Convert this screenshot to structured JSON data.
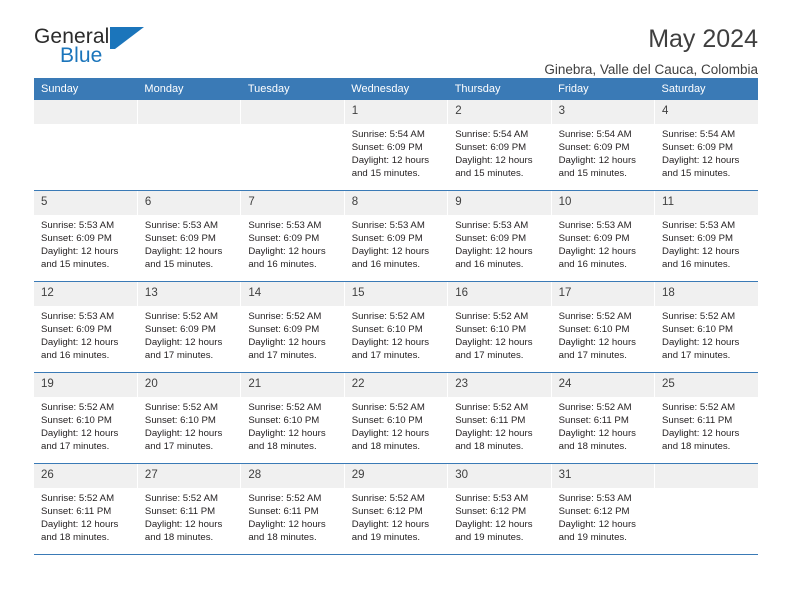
{
  "logo": {
    "text_top": "General",
    "text_bottom": "Blue",
    "mark": "triangle-logo-icon",
    "color_dark": "#2b2b2b",
    "color_blue": "#1b75bb"
  },
  "header": {
    "title": "May 2024",
    "subtitle": "Ginebra, Valle del Cauca, Colombia"
  },
  "theme": {
    "header_blue": "#3a7ab6",
    "daynum_bg": "#f0f0f0",
    "text": "#231f20"
  },
  "calendar": {
    "weekday_headers": [
      "Sunday",
      "Monday",
      "Tuesday",
      "Wednesday",
      "Thursday",
      "Friday",
      "Saturday"
    ],
    "weeks": [
      [
        {
          "day": "",
          "blank": true
        },
        {
          "day": "",
          "blank": true
        },
        {
          "day": "",
          "blank": true
        },
        {
          "day": "1",
          "sunrise": "Sunrise: 5:54 AM",
          "sunset": "Sunset: 6:09 PM",
          "daylight": "Daylight: 12 hours and 15 minutes."
        },
        {
          "day": "2",
          "sunrise": "Sunrise: 5:54 AM",
          "sunset": "Sunset: 6:09 PM",
          "daylight": "Daylight: 12 hours and 15 minutes."
        },
        {
          "day": "3",
          "sunrise": "Sunrise: 5:54 AM",
          "sunset": "Sunset: 6:09 PM",
          "daylight": "Daylight: 12 hours and 15 minutes."
        },
        {
          "day": "4",
          "sunrise": "Sunrise: 5:54 AM",
          "sunset": "Sunset: 6:09 PM",
          "daylight": "Daylight: 12 hours and 15 minutes."
        }
      ],
      [
        {
          "day": "5",
          "sunrise": "Sunrise: 5:53 AM",
          "sunset": "Sunset: 6:09 PM",
          "daylight": "Daylight: 12 hours and 15 minutes."
        },
        {
          "day": "6",
          "sunrise": "Sunrise: 5:53 AM",
          "sunset": "Sunset: 6:09 PM",
          "daylight": "Daylight: 12 hours and 15 minutes."
        },
        {
          "day": "7",
          "sunrise": "Sunrise: 5:53 AM",
          "sunset": "Sunset: 6:09 PM",
          "daylight": "Daylight: 12 hours and 16 minutes."
        },
        {
          "day": "8",
          "sunrise": "Sunrise: 5:53 AM",
          "sunset": "Sunset: 6:09 PM",
          "daylight": "Daylight: 12 hours and 16 minutes."
        },
        {
          "day": "9",
          "sunrise": "Sunrise: 5:53 AM",
          "sunset": "Sunset: 6:09 PM",
          "daylight": "Daylight: 12 hours and 16 minutes."
        },
        {
          "day": "10",
          "sunrise": "Sunrise: 5:53 AM",
          "sunset": "Sunset: 6:09 PM",
          "daylight": "Daylight: 12 hours and 16 minutes."
        },
        {
          "day": "11",
          "sunrise": "Sunrise: 5:53 AM",
          "sunset": "Sunset: 6:09 PM",
          "daylight": "Daylight: 12 hours and 16 minutes."
        }
      ],
      [
        {
          "day": "12",
          "sunrise": "Sunrise: 5:53 AM",
          "sunset": "Sunset: 6:09 PM",
          "daylight": "Daylight: 12 hours and 16 minutes."
        },
        {
          "day": "13",
          "sunrise": "Sunrise: 5:52 AM",
          "sunset": "Sunset: 6:09 PM",
          "daylight": "Daylight: 12 hours and 17 minutes."
        },
        {
          "day": "14",
          "sunrise": "Sunrise: 5:52 AM",
          "sunset": "Sunset: 6:09 PM",
          "daylight": "Daylight: 12 hours and 17 minutes."
        },
        {
          "day": "15",
          "sunrise": "Sunrise: 5:52 AM",
          "sunset": "Sunset: 6:10 PM",
          "daylight": "Daylight: 12 hours and 17 minutes."
        },
        {
          "day": "16",
          "sunrise": "Sunrise: 5:52 AM",
          "sunset": "Sunset: 6:10 PM",
          "daylight": "Daylight: 12 hours and 17 minutes."
        },
        {
          "day": "17",
          "sunrise": "Sunrise: 5:52 AM",
          "sunset": "Sunset: 6:10 PM",
          "daylight": "Daylight: 12 hours and 17 minutes."
        },
        {
          "day": "18",
          "sunrise": "Sunrise: 5:52 AM",
          "sunset": "Sunset: 6:10 PM",
          "daylight": "Daylight: 12 hours and 17 minutes."
        }
      ],
      [
        {
          "day": "19",
          "sunrise": "Sunrise: 5:52 AM",
          "sunset": "Sunset: 6:10 PM",
          "daylight": "Daylight: 12 hours and 17 minutes."
        },
        {
          "day": "20",
          "sunrise": "Sunrise: 5:52 AM",
          "sunset": "Sunset: 6:10 PM",
          "daylight": "Daylight: 12 hours and 17 minutes."
        },
        {
          "day": "21",
          "sunrise": "Sunrise: 5:52 AM",
          "sunset": "Sunset: 6:10 PM",
          "daylight": "Daylight: 12 hours and 18 minutes."
        },
        {
          "day": "22",
          "sunrise": "Sunrise: 5:52 AM",
          "sunset": "Sunset: 6:10 PM",
          "daylight": "Daylight: 12 hours and 18 minutes."
        },
        {
          "day": "23",
          "sunrise": "Sunrise: 5:52 AM",
          "sunset": "Sunset: 6:11 PM",
          "daylight": "Daylight: 12 hours and 18 minutes."
        },
        {
          "day": "24",
          "sunrise": "Sunrise: 5:52 AM",
          "sunset": "Sunset: 6:11 PM",
          "daylight": "Daylight: 12 hours and 18 minutes."
        },
        {
          "day": "25",
          "sunrise": "Sunrise: 5:52 AM",
          "sunset": "Sunset: 6:11 PM",
          "daylight": "Daylight: 12 hours and 18 minutes."
        }
      ],
      [
        {
          "day": "26",
          "sunrise": "Sunrise: 5:52 AM",
          "sunset": "Sunset: 6:11 PM",
          "daylight": "Daylight: 12 hours and 18 minutes."
        },
        {
          "day": "27",
          "sunrise": "Sunrise: 5:52 AM",
          "sunset": "Sunset: 6:11 PM",
          "daylight": "Daylight: 12 hours and 18 minutes."
        },
        {
          "day": "28",
          "sunrise": "Sunrise: 5:52 AM",
          "sunset": "Sunset: 6:11 PM",
          "daylight": "Daylight: 12 hours and 18 minutes."
        },
        {
          "day": "29",
          "sunrise": "Sunrise: 5:52 AM",
          "sunset": "Sunset: 6:12 PM",
          "daylight": "Daylight: 12 hours and 19 minutes."
        },
        {
          "day": "30",
          "sunrise": "Sunrise: 5:53 AM",
          "sunset": "Sunset: 6:12 PM",
          "daylight": "Daylight: 12 hours and 19 minutes."
        },
        {
          "day": "31",
          "sunrise": "Sunrise: 5:53 AM",
          "sunset": "Sunset: 6:12 PM",
          "daylight": "Daylight: 12 hours and 19 minutes."
        },
        {
          "day": "",
          "blank": true
        }
      ]
    ]
  }
}
